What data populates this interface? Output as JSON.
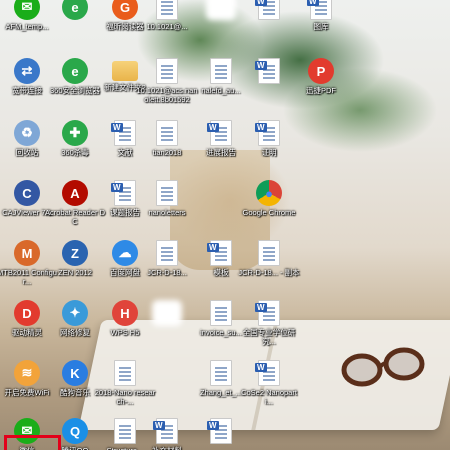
{
  "colors": {
    "selection_outline": "#e2001a"
  },
  "icons": [
    {
      "label": "AFM_temp...",
      "icon": "wechat-icon",
      "bg": "#1aad19"
    },
    {
      "label": "",
      "icon": "360-browser-icon",
      "bg": "#2aa84a"
    },
    {
      "label": "福昕阅读器",
      "icon": "foxit-reader-icon",
      "bg": "#e95c1b"
    },
    {
      "label": "10.1021@...",
      "icon": "pdf-document-icon",
      "bg": "#ffffff"
    },
    {
      "label": "",
      "icon": "blurred-icon",
      "bg": "#ffffff"
    },
    {
      "label": "",
      "icon": "word-document-icon",
      "bg": "#ffffff"
    },
    {
      "label": "图库",
      "icon": "word-document-icon",
      "bg": "#ffffff"
    },
    {
      "label": "宽带连接",
      "icon": "network-connection-icon",
      "bg": "#3a78c9"
    },
    {
      "label": "360安全浏览器",
      "icon": "360-browser-icon",
      "bg": "#2aa84a"
    },
    {
      "label": "新建文件夹2",
      "icon": "folder-icon",
      "bg": "#e9b44a"
    },
    {
      "label": "10.1021@acs.nanolett.8b01592",
      "icon": "pdf-document-icon",
      "bg": "#ffffff"
    },
    {
      "label": "nalefd_au...",
      "icon": "pdf-document-icon",
      "bg": "#ffffff"
    },
    {
      "label": "",
      "icon": "word-document-icon",
      "bg": "#ffffff"
    },
    {
      "label": "迅捷PDF",
      "icon": "pdf-converter-icon",
      "bg": "#e23b2e"
    },
    {
      "label": "回收站",
      "icon": "recycle-bin-icon",
      "bg": "#7fa7d6"
    },
    {
      "label": "360杀毒",
      "icon": "360-antivirus-icon",
      "bg": "#2aa84a"
    },
    {
      "label": "文献",
      "icon": "word-document-icon",
      "bg": "#ffffff"
    },
    {
      "label": "tian2018",
      "icon": "pdf-document-icon",
      "bg": "#ffffff"
    },
    {
      "label": "进展报告",
      "icon": "word-document-icon",
      "bg": "#ffffff"
    },
    {
      "label": "证明",
      "icon": "word-document-icon",
      "bg": "#ffffff"
    },
    {
      "label": "CAJViewer 7.1",
      "icon": "cajviewer-icon",
      "bg": "#3357a3"
    },
    {
      "label": "Acrobat Reader DC",
      "icon": "acrobat-reader-icon",
      "bg": "#b30b00"
    },
    {
      "label": "课题报告",
      "icon": "word-document-icon",
      "bg": "#ffffff"
    },
    {
      "label": "nanoletters",
      "icon": "pdf-document-icon",
      "bg": "#ffffff"
    },
    {
      "label": "Google Chrome",
      "icon": "chrome-icon",
      "bg": "#ffffff"
    },
    {
      "label": "MTB2011 Configur...",
      "icon": "matlab-icon",
      "bg": "#d9692a"
    },
    {
      "label": "ZEN 2012",
      "icon": "zen-icon",
      "bg": "#2a64b0"
    },
    {
      "label": "百度网盘",
      "icon": "baidu-netdisk-icon",
      "bg": "#2e8ae6"
    },
    {
      "label": "JCR-D-18...",
      "icon": "pdf-document-icon",
      "bg": "#ffffff"
    },
    {
      "label": "模板",
      "icon": "word-document-icon",
      "bg": "#ffffff"
    },
    {
      "label": "JCR-D-18... - 副本",
      "icon": "pdf-document-icon",
      "bg": "#ffffff"
    },
    {
      "label": "驱动精灵",
      "icon": "driver-genius-icon",
      "bg": "#e23b2e"
    },
    {
      "label": "网络修复",
      "icon": "network-repair-icon",
      "bg": "#3a9ad9"
    },
    {
      "label": "WPS H5",
      "icon": "wps-h5-icon",
      "bg": "#e0443a"
    },
    {
      "label": "",
      "icon": "blurred-icon",
      "bg": "#ffffff"
    },
    {
      "label": "invoice_su...",
      "icon": "pdf-document-icon",
      "bg": "#ffffff"
    },
    {
      "label": "全国专业学位研究...",
      "icon": "word-document-icon",
      "bg": "#ffffff"
    },
    {
      "label": "开启免费WiFi",
      "icon": "free-wifi-icon",
      "bg": "#f2a33a"
    },
    {
      "label": "酷狗音乐",
      "icon": "kugou-music-icon",
      "bg": "#2a7de1"
    },
    {
      "label": "2018-Nano research-...",
      "icon": "pdf-document-icon",
      "bg": "#ffffff"
    },
    {
      "label": "Zhang_et_...",
      "icon": "pdf-document-icon",
      "bg": "#ffffff"
    },
    {
      "label": "CoSe2 Nanoparti...",
      "icon": "word-document-icon",
      "bg": "#ffffff"
    },
    {
      "label": "微信",
      "icon": "wechat-icon",
      "bg": "#1aad19"
    },
    {
      "label": "腾讯QQ",
      "icon": "qq-icon",
      "bg": "#1a8fe6"
    },
    {
      "label": "Structure...",
      "icon": "pdf-document-icon",
      "bg": "#ffffff"
    },
    {
      "label": "补充材料",
      "icon": "word-document-icon",
      "bg": "#ffffff"
    },
    {
      "label": "",
      "icon": "word-document-icon",
      "bg": "#ffffff"
    }
  ]
}
